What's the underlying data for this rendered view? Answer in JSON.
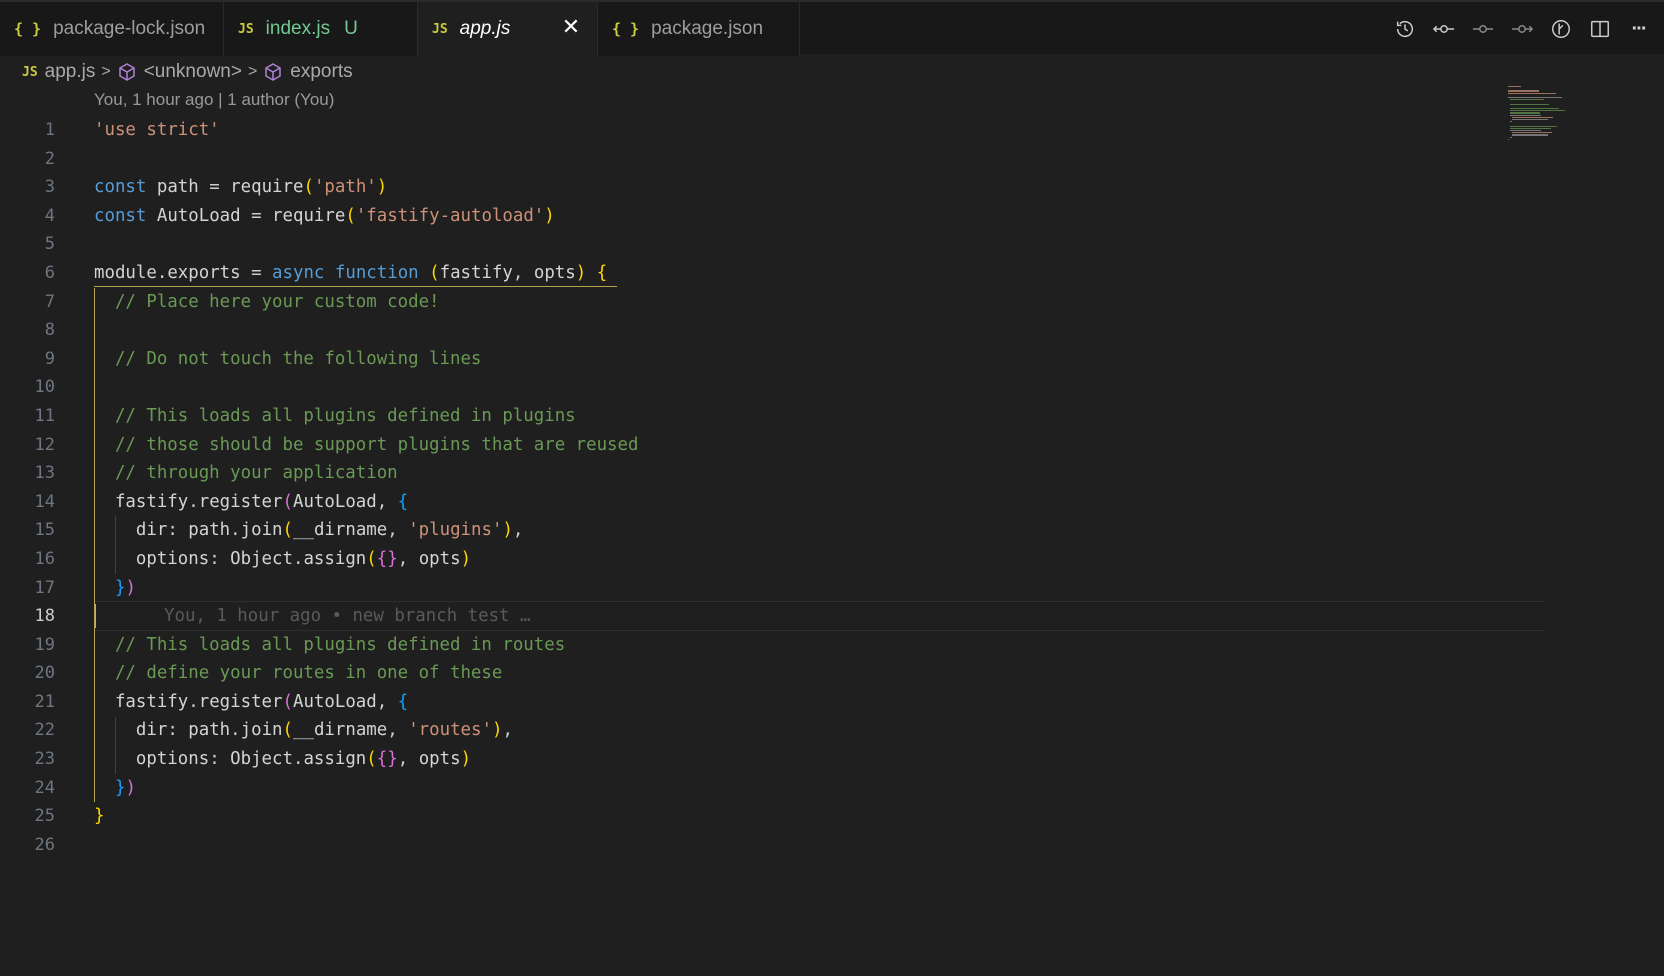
{
  "tabs": [
    {
      "label": "package-lock.json",
      "icon": "json-icon",
      "icon_text": "{ }",
      "active": false
    },
    {
      "label": "index.js",
      "icon": "javascript-icon",
      "icon_text": "JS",
      "active": false,
      "git_status": "U"
    },
    {
      "label": "app.js",
      "icon": "javascript-icon",
      "icon_text": "JS",
      "active": true,
      "close_glyph": "✕"
    },
    {
      "label": "package.json",
      "icon": "json-icon",
      "icon_text": "{ }",
      "active": false
    }
  ],
  "toolbar": {
    "actions": [
      "timeline-icon",
      "git-compare-icon",
      "git-commit-icon",
      "git-next-icon",
      "git-lens-icon",
      "split-editor-icon",
      "more-actions-icon"
    ],
    "more_glyph": "···"
  },
  "breadcrumb": {
    "file_icon": "JS",
    "items": [
      "app.js",
      "<unknown>",
      "exports"
    ],
    "separator": ">"
  },
  "codelens": "You, 1 hour ago | 1 author (You)",
  "editor": {
    "current_line": 18,
    "blame": "You, 1 hour ago • new branch test …",
    "lines": [
      "'use strict'",
      "",
      "const path = require('path')",
      "const AutoLoad = require('fastify-autoload')",
      "",
      "module.exports = async function (fastify, opts) {",
      "  // Place here your custom code!",
      "",
      "  // Do not touch the following lines",
      "",
      "  // This loads all plugins defined in plugins",
      "  // those should be support plugins that are reused",
      "  // through your application",
      "  fastify.register(AutoLoad, {",
      "    dir: path.join(__dirname, 'plugins'),",
      "    options: Object.assign({}, opts)",
      "  })",
      "",
      "  // This loads all plugins defined in routes",
      "  // define your routes in one of these",
      "  fastify.register(AutoLoad, {",
      "    dir: path.join(__dirname, 'routes'),",
      "    options: Object.assign({}, opts)",
      "  })",
      "}",
      ""
    ]
  },
  "colors": {
    "background": "#1f1f1f",
    "string": "#ce9178",
    "keyword": "#569cd6",
    "comment": "#6a9955",
    "bracket_gold": "#ffd700",
    "bracket_pink": "#da70d6",
    "bracket_blue": "#179fff",
    "untracked": "#73c991",
    "json_icon": "#cbcb41"
  }
}
